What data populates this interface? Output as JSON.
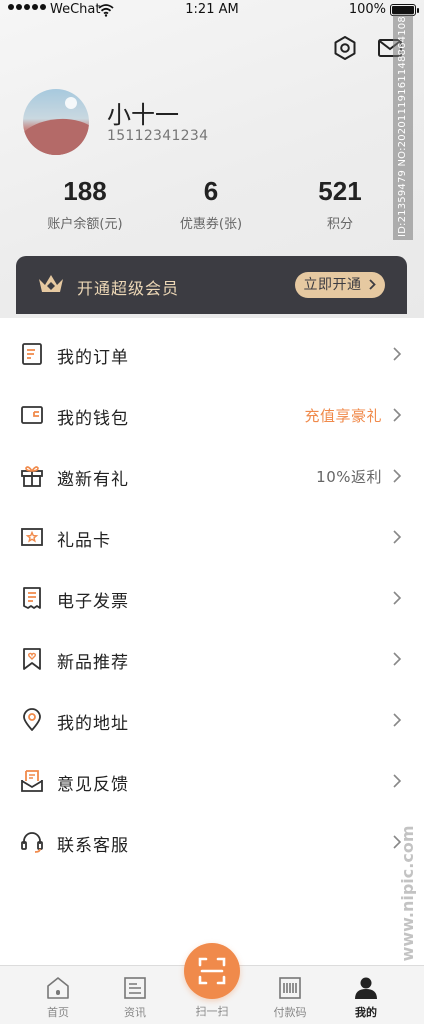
{
  "status_bar": {
    "carrier": "WeChat",
    "time": "1:21 AM",
    "battery": "100%"
  },
  "header": {
    "settings_icon": "settings-hexagon-icon",
    "mail_icon": "mail-icon"
  },
  "watermark": {
    "text": "ID:21359479 NO:20201119161148864108",
    "side_text": "昵图网 www.nipic.com"
  },
  "profile": {
    "name": "小十一",
    "phone": "15112341234"
  },
  "stats": [
    {
      "value": "188",
      "label": "账户余额(元)"
    },
    {
      "value": "6",
      "label": "优惠券(张)"
    },
    {
      "value": "521",
      "label": "积分"
    }
  ],
  "vip": {
    "text": "开通超级会员",
    "button": "立即开通",
    "accent": "#e6c9a1",
    "background": "#3c3c42"
  },
  "menu": [
    {
      "label": "我的订单",
      "icon": "order-list-icon",
      "extra": ""
    },
    {
      "label": "我的钱包",
      "icon": "wallet-icon",
      "extra": "充值享豪礼",
      "extra_color": "#f08a4b"
    },
    {
      "label": "邀新有礼",
      "icon": "gift-icon",
      "extra": "10%返利",
      "extra_color": "#666666"
    },
    {
      "label": "礼品卡",
      "icon": "gift-card-icon",
      "extra": ""
    },
    {
      "label": "电子发票",
      "icon": "invoice-icon",
      "extra": ""
    },
    {
      "label": "新品推荐",
      "icon": "bookmark-heart-icon",
      "extra": ""
    },
    {
      "label": "我的地址",
      "icon": "location-pin-icon",
      "extra": ""
    },
    {
      "label": "意见反馈",
      "icon": "feedback-icon",
      "extra": ""
    },
    {
      "label": "联系客服",
      "icon": "headset-icon",
      "extra": ""
    }
  ],
  "tabs": [
    {
      "label": "首页",
      "icon": "home-icon"
    },
    {
      "label": "资讯",
      "icon": "news-icon"
    },
    {
      "label": "扫一扫",
      "icon": "scan-icon"
    },
    {
      "label": "付款码",
      "icon": "barcode-icon"
    },
    {
      "label": "我的",
      "icon": "profile-icon",
      "active": true
    }
  ],
  "colors": {
    "accent_orange": "#f08a4b",
    "text_primary": "#222222"
  }
}
